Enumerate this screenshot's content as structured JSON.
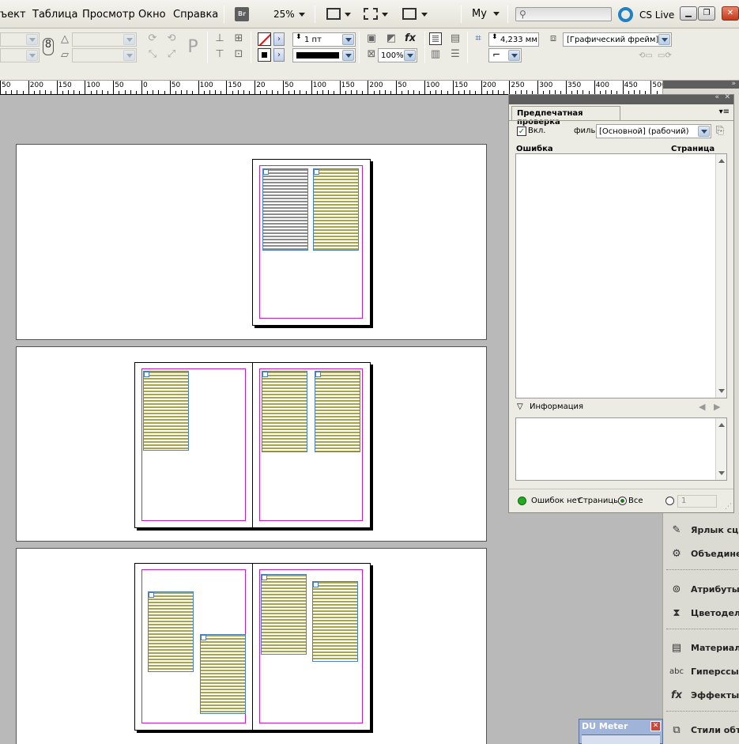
{
  "menu": {
    "items": [
      "ъект",
      "Таблица",
      "Просмотр",
      "Окно",
      "Справка"
    ],
    "bridge": "Br",
    "zoom": "25%",
    "workspace": "My",
    "cslive": "CS Live"
  },
  "control": {
    "stroke_weight": "1 пт",
    "size_value": "4,233 мм",
    "opacity": "100%",
    "style": "[Графический фрейм]",
    "placeholder_p": "P"
  },
  "ruler": {
    "labels": [
      "50",
      "200",
      "150",
      "100",
      "50",
      "0",
      "50",
      "100",
      "150",
      "20",
      "50",
      "100",
      "150",
      "200",
      "50",
      "100",
      "150",
      "200",
      "250",
      "300",
      "350",
      "400",
      "450",
      "500"
    ]
  },
  "preflight": {
    "title": "Предпечатная проверка",
    "enable_label": "Вкл.",
    "profile_label": "филь:",
    "profile_value": "[Основной] (рабочий)",
    "col_error": "Ошибка",
    "col_page": "Страница",
    "info_label": "Информация",
    "status": "Ошибок нет",
    "pages_label": "Страницы:",
    "all_label": "Все",
    "range_value": "1"
  },
  "dock": {
    "items": [
      {
        "label": "Ярлык сц...",
        "icon": "script-label-icon"
      },
      {
        "label": "Объедине...",
        "icon": "merge-icon"
      },
      {
        "label": "Атрибуты",
        "icon": "attributes-icon"
      },
      {
        "label": "Цветодел...",
        "icon": "separations-icon"
      },
      {
        "label": "Материал",
        "icon": "material-icon"
      },
      {
        "label": "Гиперссы...",
        "icon": "hyperlinks-icon"
      },
      {
        "label": "Эффекты",
        "icon": "effects-icon"
      },
      {
        "label": "Стили объ...",
        "icon": "object-styles-icon"
      }
    ]
  },
  "dumeter": {
    "title": "DU Meter"
  },
  "colors": {
    "margin": "#c61ec6",
    "frame": "#4a7fc1",
    "text_highlight": "#a8a448",
    "status_ok": "#22aa22"
  }
}
